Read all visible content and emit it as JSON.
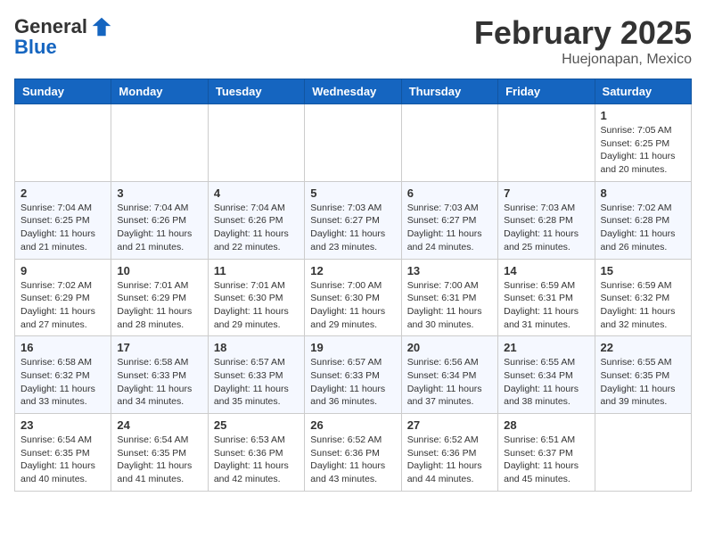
{
  "header": {
    "logo_line1": "General",
    "logo_line2": "Blue",
    "month": "February 2025",
    "location": "Huejonapan, Mexico"
  },
  "days_of_week": [
    "Sunday",
    "Monday",
    "Tuesday",
    "Wednesday",
    "Thursday",
    "Friday",
    "Saturday"
  ],
  "weeks": [
    [
      {
        "day": "",
        "info": ""
      },
      {
        "day": "",
        "info": ""
      },
      {
        "day": "",
        "info": ""
      },
      {
        "day": "",
        "info": ""
      },
      {
        "day": "",
        "info": ""
      },
      {
        "day": "",
        "info": ""
      },
      {
        "day": "1",
        "info": "Sunrise: 7:05 AM\nSunset: 6:25 PM\nDaylight: 11 hours\nand 20 minutes."
      }
    ],
    [
      {
        "day": "2",
        "info": "Sunrise: 7:04 AM\nSunset: 6:25 PM\nDaylight: 11 hours\nand 21 minutes."
      },
      {
        "day": "3",
        "info": "Sunrise: 7:04 AM\nSunset: 6:26 PM\nDaylight: 11 hours\nand 21 minutes."
      },
      {
        "day": "4",
        "info": "Sunrise: 7:04 AM\nSunset: 6:26 PM\nDaylight: 11 hours\nand 22 minutes."
      },
      {
        "day": "5",
        "info": "Sunrise: 7:03 AM\nSunset: 6:27 PM\nDaylight: 11 hours\nand 23 minutes."
      },
      {
        "day": "6",
        "info": "Sunrise: 7:03 AM\nSunset: 6:27 PM\nDaylight: 11 hours\nand 24 minutes."
      },
      {
        "day": "7",
        "info": "Sunrise: 7:03 AM\nSunset: 6:28 PM\nDaylight: 11 hours\nand 25 minutes."
      },
      {
        "day": "8",
        "info": "Sunrise: 7:02 AM\nSunset: 6:28 PM\nDaylight: 11 hours\nand 26 minutes."
      }
    ],
    [
      {
        "day": "9",
        "info": "Sunrise: 7:02 AM\nSunset: 6:29 PM\nDaylight: 11 hours\nand 27 minutes."
      },
      {
        "day": "10",
        "info": "Sunrise: 7:01 AM\nSunset: 6:29 PM\nDaylight: 11 hours\nand 28 minutes."
      },
      {
        "day": "11",
        "info": "Sunrise: 7:01 AM\nSunset: 6:30 PM\nDaylight: 11 hours\nand 29 minutes."
      },
      {
        "day": "12",
        "info": "Sunrise: 7:00 AM\nSunset: 6:30 PM\nDaylight: 11 hours\nand 29 minutes."
      },
      {
        "day": "13",
        "info": "Sunrise: 7:00 AM\nSunset: 6:31 PM\nDaylight: 11 hours\nand 30 minutes."
      },
      {
        "day": "14",
        "info": "Sunrise: 6:59 AM\nSunset: 6:31 PM\nDaylight: 11 hours\nand 31 minutes."
      },
      {
        "day": "15",
        "info": "Sunrise: 6:59 AM\nSunset: 6:32 PM\nDaylight: 11 hours\nand 32 minutes."
      }
    ],
    [
      {
        "day": "16",
        "info": "Sunrise: 6:58 AM\nSunset: 6:32 PM\nDaylight: 11 hours\nand 33 minutes."
      },
      {
        "day": "17",
        "info": "Sunrise: 6:58 AM\nSunset: 6:33 PM\nDaylight: 11 hours\nand 34 minutes."
      },
      {
        "day": "18",
        "info": "Sunrise: 6:57 AM\nSunset: 6:33 PM\nDaylight: 11 hours\nand 35 minutes."
      },
      {
        "day": "19",
        "info": "Sunrise: 6:57 AM\nSunset: 6:33 PM\nDaylight: 11 hours\nand 36 minutes."
      },
      {
        "day": "20",
        "info": "Sunrise: 6:56 AM\nSunset: 6:34 PM\nDaylight: 11 hours\nand 37 minutes."
      },
      {
        "day": "21",
        "info": "Sunrise: 6:55 AM\nSunset: 6:34 PM\nDaylight: 11 hours\nand 38 minutes."
      },
      {
        "day": "22",
        "info": "Sunrise: 6:55 AM\nSunset: 6:35 PM\nDaylight: 11 hours\nand 39 minutes."
      }
    ],
    [
      {
        "day": "23",
        "info": "Sunrise: 6:54 AM\nSunset: 6:35 PM\nDaylight: 11 hours\nand 40 minutes."
      },
      {
        "day": "24",
        "info": "Sunrise: 6:54 AM\nSunset: 6:35 PM\nDaylight: 11 hours\nand 41 minutes."
      },
      {
        "day": "25",
        "info": "Sunrise: 6:53 AM\nSunset: 6:36 PM\nDaylight: 11 hours\nand 42 minutes."
      },
      {
        "day": "26",
        "info": "Sunrise: 6:52 AM\nSunset: 6:36 PM\nDaylight: 11 hours\nand 43 minutes."
      },
      {
        "day": "27",
        "info": "Sunrise: 6:52 AM\nSunset: 6:36 PM\nDaylight: 11 hours\nand 44 minutes."
      },
      {
        "day": "28",
        "info": "Sunrise: 6:51 AM\nSunset: 6:37 PM\nDaylight: 11 hours\nand 45 minutes."
      },
      {
        "day": "",
        "info": ""
      }
    ]
  ]
}
